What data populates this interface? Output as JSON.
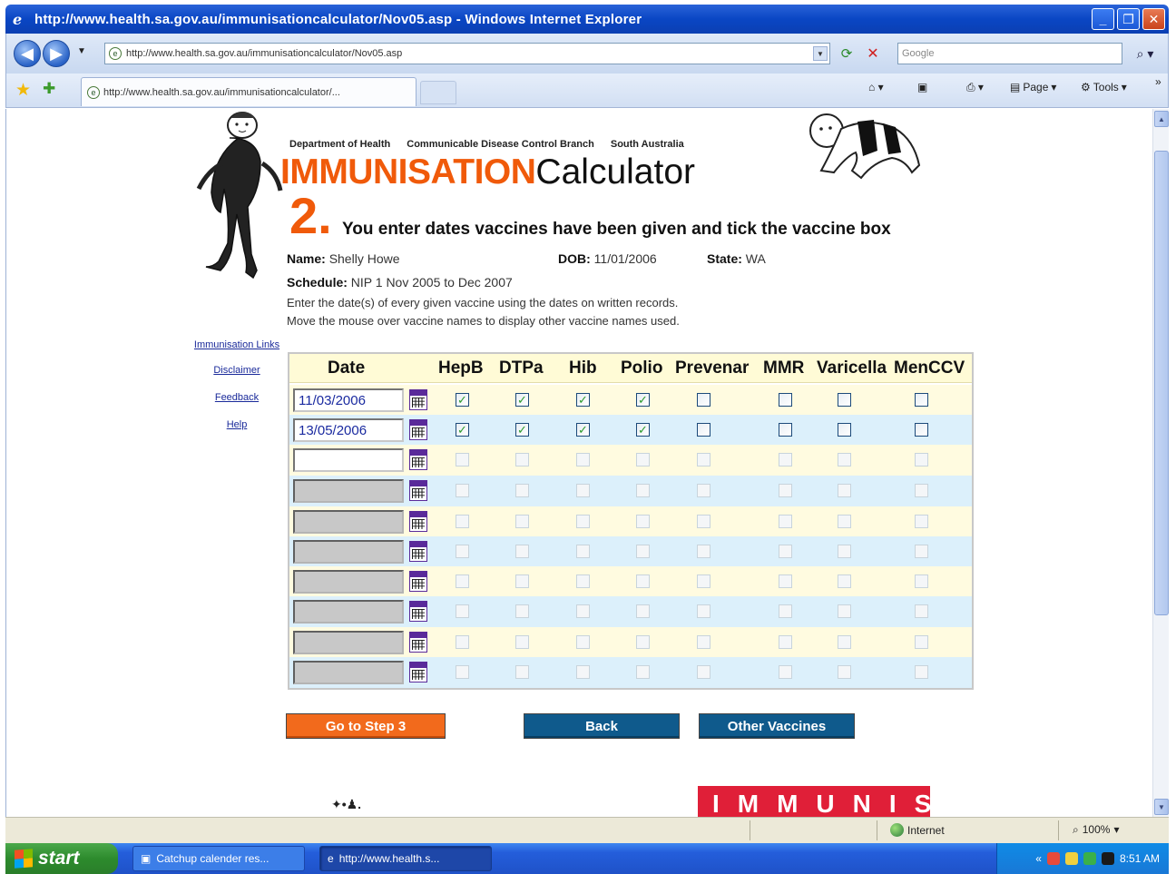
{
  "window": {
    "title": "http://www.health.sa.gov.au/immunisationcalculator/Nov05.asp - Windows Internet Explorer",
    "url": "http://www.health.sa.gov.au/immunisationcalculator/Nov05.asp",
    "search_placeholder": "Google",
    "tab_label": "http://www.health.sa.gov.au/immunisationcalculator/...",
    "page_menu": "Page",
    "tools_menu": "Tools"
  },
  "page": {
    "dept": "Department of Health",
    "branch": "Communicable Disease Control Branch",
    "state_name": "South Australia",
    "brand_imm": "IMMUNISATION",
    "brand_calc": "Calculator",
    "step_number": "2",
    "step_text": "You enter dates vaccines have been given and tick the vaccine box",
    "name_label": "Name:",
    "name_value": "Shelly Howe",
    "dob_label": "DOB:",
    "dob_value": "11/01/2006",
    "state_label": "State:",
    "state_value": "WA",
    "schedule_label": "Schedule:",
    "schedule_value": "NIP 1 Nov 2005 to Dec 2007",
    "instruction1": "Enter the date(s) of every given vaccine using the dates on written records.",
    "instruction2": "Move the mouse over vaccine names to display other vaccine names used."
  },
  "sidebar": {
    "links": [
      "Immunisation Links",
      "Disclaimer",
      "Feedback",
      "Help"
    ]
  },
  "table": {
    "columns": [
      "Date",
      "HepB",
      "DTPa",
      "Hib",
      "Polio",
      "Prevenar",
      "MMR",
      "Varicella",
      "MenCCV"
    ],
    "rows": [
      {
        "date": "11/03/2006",
        "enabled": true,
        "active": true,
        "checks": [
          true,
          true,
          true,
          true,
          false,
          false,
          false,
          false
        ]
      },
      {
        "date": "13/05/2006",
        "enabled": true,
        "active": true,
        "checks": [
          true,
          true,
          true,
          true,
          false,
          false,
          false,
          false
        ]
      },
      {
        "date": "",
        "enabled": true,
        "active": false,
        "checks": [
          false,
          false,
          false,
          false,
          false,
          false,
          false,
          false
        ]
      },
      {
        "date": "",
        "enabled": false,
        "active": false,
        "checks": [
          false,
          false,
          false,
          false,
          false,
          false,
          false,
          false
        ]
      },
      {
        "date": "",
        "enabled": false,
        "active": false,
        "checks": [
          false,
          false,
          false,
          false,
          false,
          false,
          false,
          false
        ]
      },
      {
        "date": "",
        "enabled": false,
        "active": false,
        "checks": [
          false,
          false,
          false,
          false,
          false,
          false,
          false,
          false
        ]
      },
      {
        "date": "",
        "enabled": false,
        "active": false,
        "checks": [
          false,
          false,
          false,
          false,
          false,
          false,
          false,
          false
        ]
      },
      {
        "date": "",
        "enabled": false,
        "active": false,
        "checks": [
          false,
          false,
          false,
          false,
          false,
          false,
          false,
          false
        ]
      },
      {
        "date": "",
        "enabled": false,
        "active": false,
        "checks": [
          false,
          false,
          false,
          false,
          false,
          false,
          false,
          false
        ]
      },
      {
        "date": "",
        "enabled": false,
        "active": false,
        "checks": [
          false,
          false,
          false,
          false,
          false,
          false,
          false,
          false
        ]
      }
    ]
  },
  "buttons": {
    "next": "Go to Step 3",
    "back": "Back",
    "other": "Other Vaccines"
  },
  "banner": "IMMUNISE",
  "status": {
    "zone": "Internet",
    "zoom": "100%"
  },
  "taskbar": {
    "start": "start",
    "items": [
      "Catchup calender res...",
      "http://www.health.s..."
    ],
    "clock": "8:51 AM"
  },
  "colors": {
    "accent_orange": "#f05a0a",
    "button_blue": "#0f5a8c",
    "banner_red": "#e01f38"
  }
}
